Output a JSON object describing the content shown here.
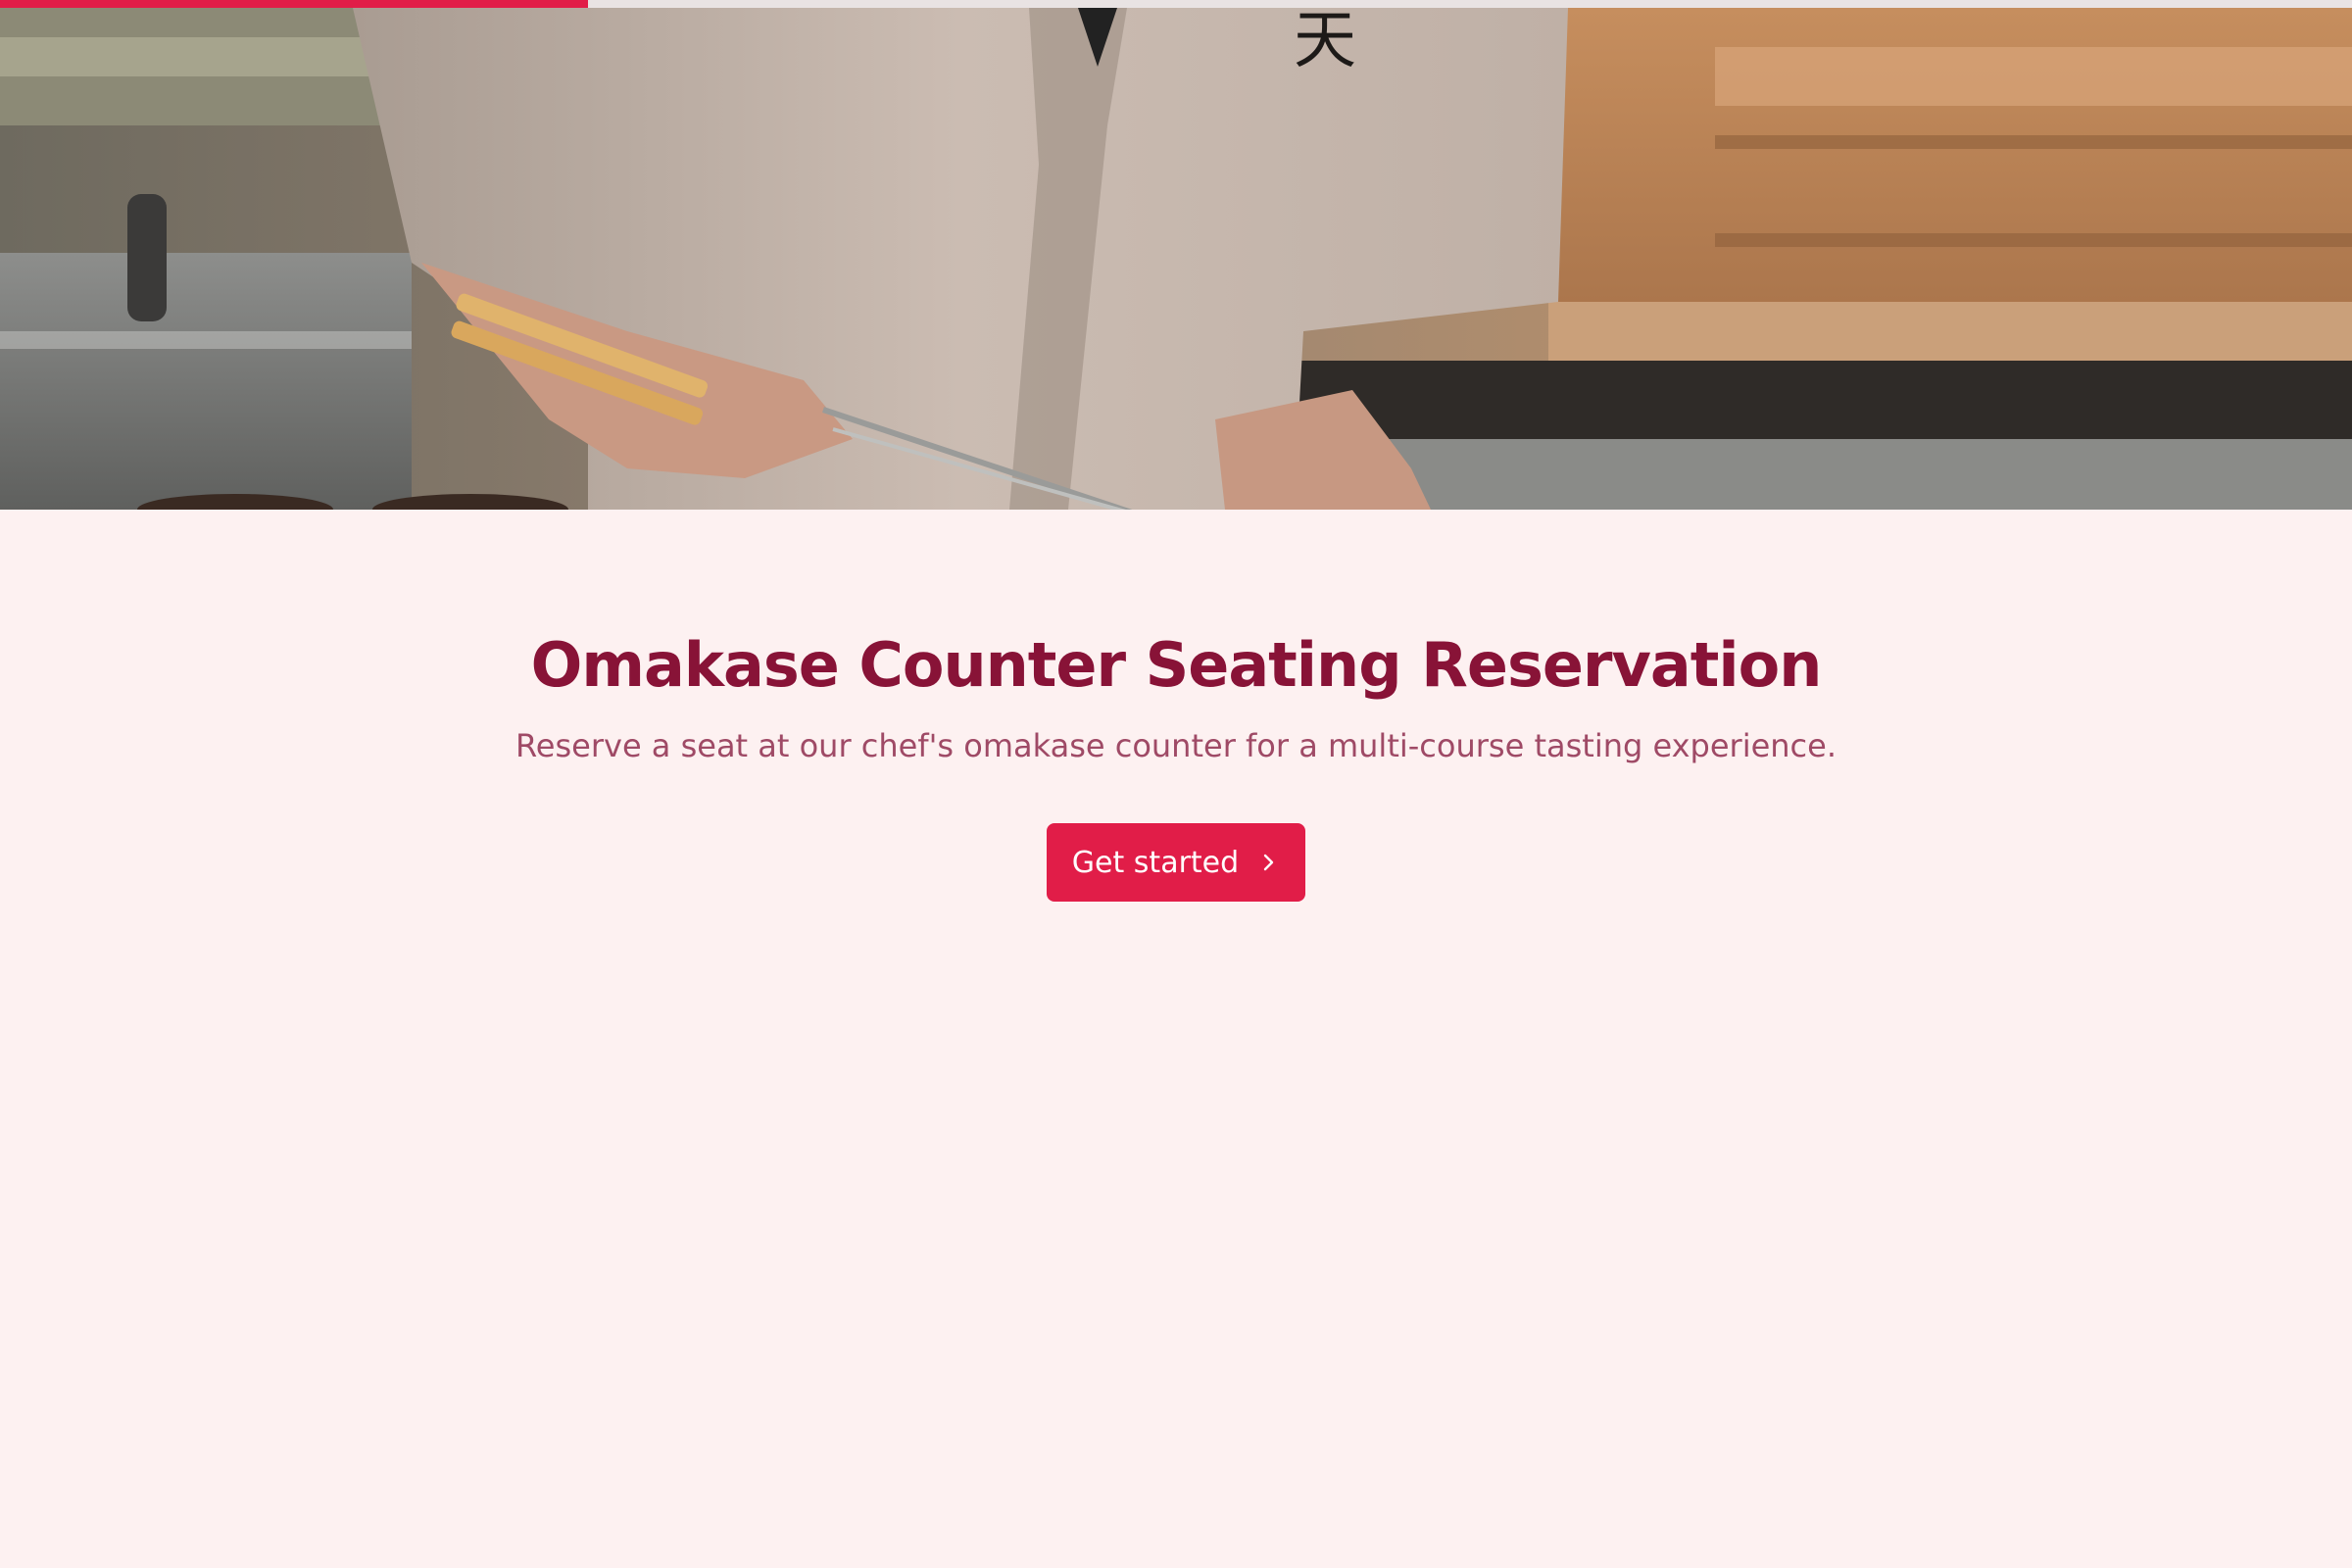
{
  "progress": {
    "fraction": 0.25,
    "color": "#e11d48"
  },
  "hero": {
    "description_icon": "chef-photo"
  },
  "main": {
    "title": "Omakase Counter Seating Reservation",
    "subtitle": "Reserve a seat at our chef's omakase counter for a multi-course tasting experience.",
    "cta_label": "Get started",
    "cta_icon": "chevron-right-icon"
  },
  "colors": {
    "background": "#fdf1f1",
    "title": "#881337",
    "subtitle": "#9f4a66",
    "accent": "#e11d48"
  }
}
